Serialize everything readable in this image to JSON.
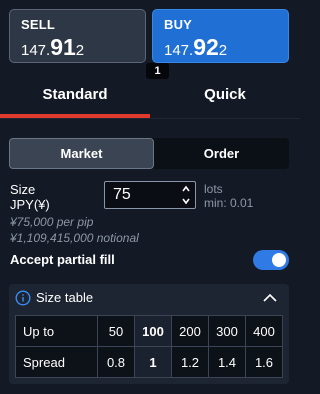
{
  "sell": {
    "label": "SELL",
    "price_big": "147.",
    "price_pips": "91",
    "price_frac": "2"
  },
  "buy": {
    "label": "BUY",
    "price_big": "147.",
    "price_pips": "92",
    "price_frac": "2"
  },
  "spread": "1",
  "order_tabs": {
    "standard": "Standard",
    "quick": "Quick",
    "active": "Standard"
  },
  "order_kind": {
    "market": "Market",
    "order": "Order",
    "active": "Market"
  },
  "size": {
    "label_line1": "Size",
    "label_line2": "JPY(¥)",
    "value": "75",
    "unit": "lots",
    "min": "min: 0.01",
    "pip_value": "¥75,000 per pip",
    "notional": "¥1,109,415,000 notional"
  },
  "partial_fill": {
    "label": "Accept partial fill",
    "enabled": true
  },
  "size_table": {
    "title": "Size table",
    "row_labels": [
      "Up to",
      "Spread"
    ],
    "up_to": [
      "50",
      "100",
      "200",
      "300",
      "400"
    ],
    "spreads": [
      "0.8",
      "1",
      "1.2",
      "1.4",
      "1.6"
    ],
    "selected_index": 1
  },
  "colors": {
    "background": "#131a25",
    "buy": "#1f6fd4",
    "sell": "#2e3745",
    "tab_underline": "#e03a2f",
    "toggle_on": "#2f7ae5"
  }
}
